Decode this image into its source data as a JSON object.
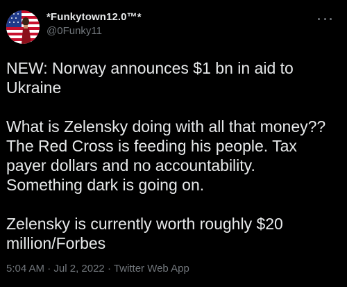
{
  "author": {
    "display_name": "*Funkytown12.0™*",
    "handle": "@0Funky11"
  },
  "icons": {
    "more": "more-horizontal-icon",
    "avatar": "avatar-flag-portrait"
  },
  "colors": {
    "background": "#000000",
    "text_primary": "#e7e9ea",
    "text_secondary": "#71767b"
  },
  "tweet": {
    "paragraphs": [
      "NEW: Norway announces $1 bn in aid to Ukraine",
      "What is Zelensky doing with all that money?? The Red Cross is feeding his people. Tax payer dollars and no accountability. Something dark is going on.",
      "Zelensky is currently worth roughly $20 million/Forbes"
    ]
  },
  "meta": {
    "time": "5:04 AM",
    "separator": "·",
    "date": "Jul 2, 2022",
    "source": "Twitter Web App"
  }
}
